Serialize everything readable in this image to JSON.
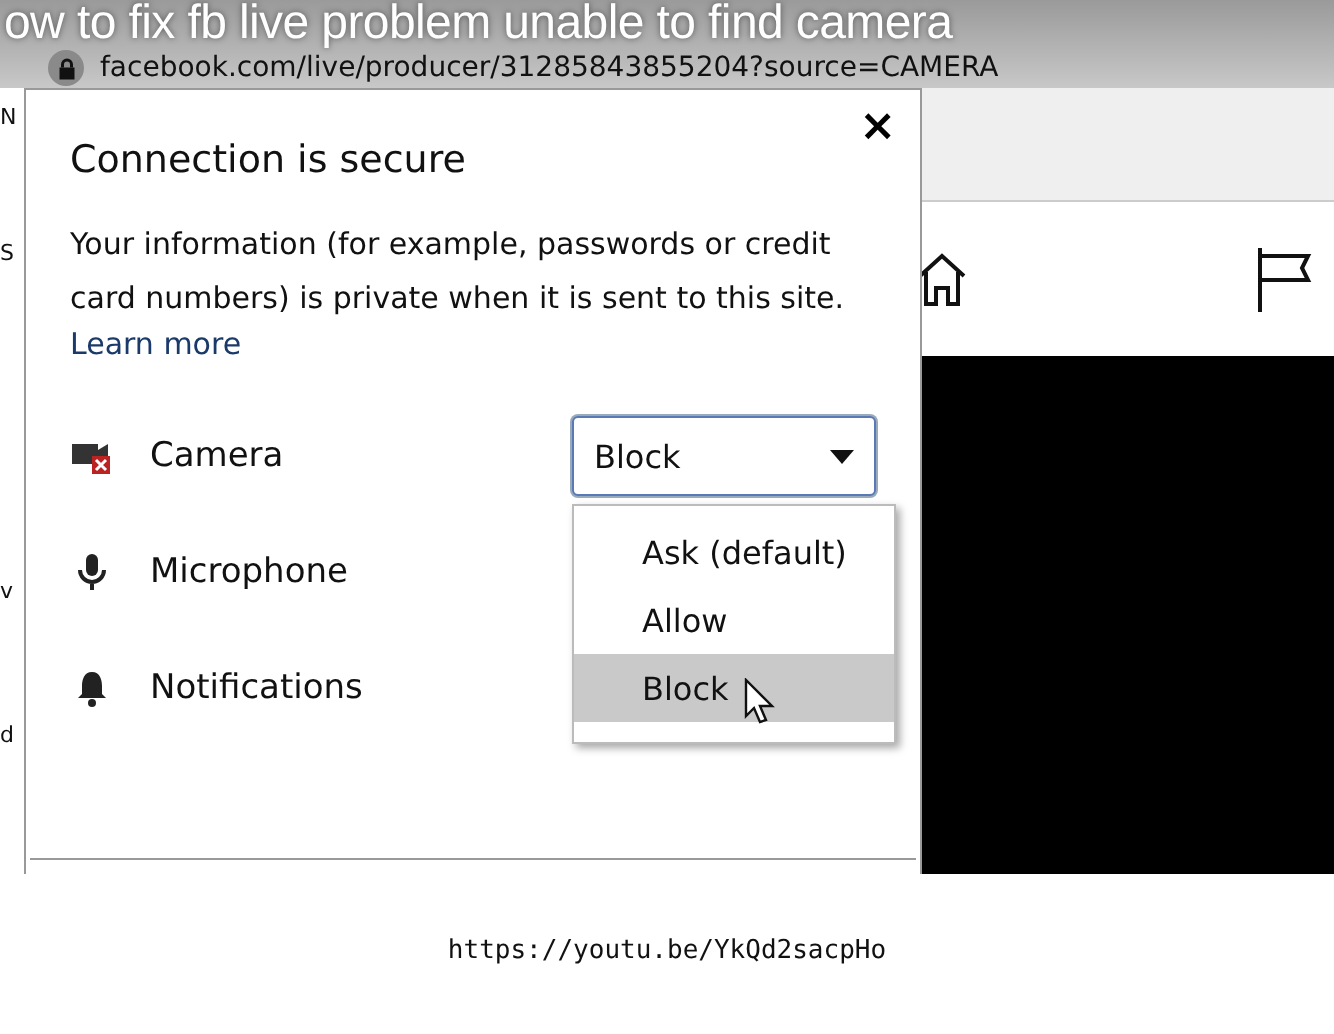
{
  "video_title_overlay": "ow to fix fb live problem unable to find camera",
  "address_bar": {
    "url": "facebook.com/live/producer/31285843855204?source=CAMERA"
  },
  "page_fragments": [
    "N",
    "S",
    "v",
    "d"
  ],
  "popup": {
    "title": "Connection is secure",
    "close": "×",
    "message": "Your information (for example, passwords or credit card numbers) is private when it is sent to this site.",
    "link": "Learn more",
    "permissions": [
      {
        "kind": "camera",
        "label": "Camera",
        "blocked": true,
        "select": {
          "value": "Block",
          "expanded": true,
          "options": [
            {
              "label": "Ask (default)",
              "selected": false
            },
            {
              "label": "Allow",
              "selected": false
            },
            {
              "label": "Block",
              "selected": true
            }
          ]
        }
      },
      {
        "kind": "microphone",
        "label": "Microphone",
        "blocked": false
      },
      {
        "kind": "notifications",
        "label": "Notifications",
        "blocked": false
      }
    ]
  },
  "caption": "https://youtu.be/YkQd2sacpHo"
}
